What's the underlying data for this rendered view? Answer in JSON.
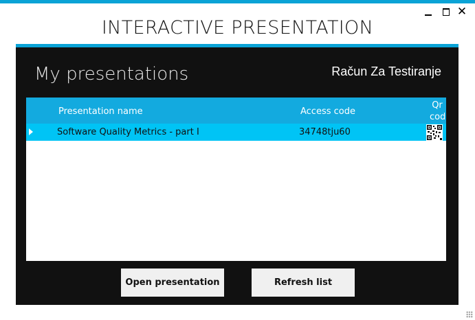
{
  "window": {
    "minimize_glyph": "",
    "maximize_glyph": "",
    "close_glyph": "✕"
  },
  "app_title": "INTERACTIVE PRESENTATION",
  "panel": {
    "title": "My presentations",
    "account_name": "Račun Za Testiranje"
  },
  "grid": {
    "columns": [
      "Presentation name",
      "Access code",
      "Qr cod"
    ],
    "rows": [
      {
        "name": "Software Quality Metrics - part I",
        "access_code": "34748tju60",
        "qr": "qr-code-icon",
        "selected": true
      }
    ]
  },
  "buttons": {
    "open_label": "Open presentation",
    "refresh_label": "Refresh list"
  },
  "colors": {
    "accent": "#0aa3d6",
    "header": "#13aadf",
    "selected_row": "#00c4f5",
    "panel_bg": "#111111"
  }
}
